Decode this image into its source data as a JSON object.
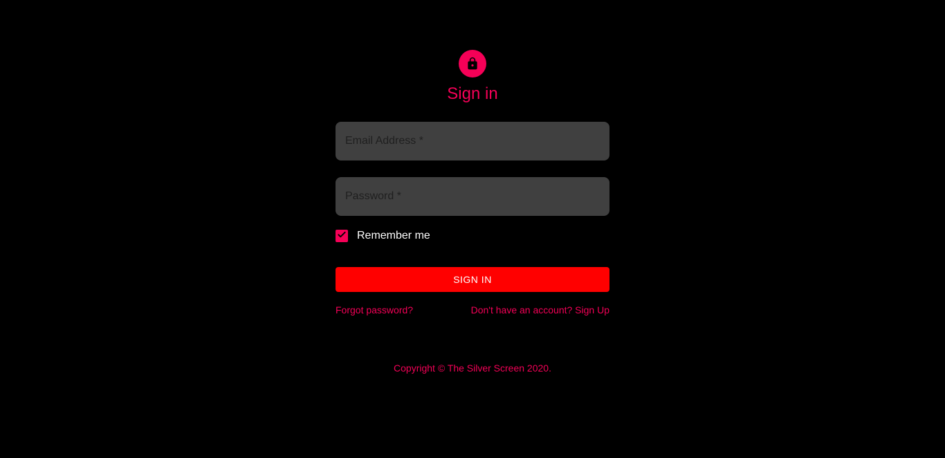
{
  "header": {
    "title": "Sign in",
    "icon": "lock-icon"
  },
  "form": {
    "email_placeholder": "Email Address *",
    "password_placeholder": "Password *",
    "remember_label": "Remember me",
    "remember_checked": true,
    "submit_label": "Sign In"
  },
  "links": {
    "forgot_password": "Forgot password?",
    "sign_up": "Don't have an account? Sign Up"
  },
  "footer": {
    "copyright": "Copyright © The Silver Screen 2020."
  },
  "colors": {
    "background": "#000000",
    "accent": "#f50057",
    "button": "#ff0000",
    "field": "#404040"
  }
}
